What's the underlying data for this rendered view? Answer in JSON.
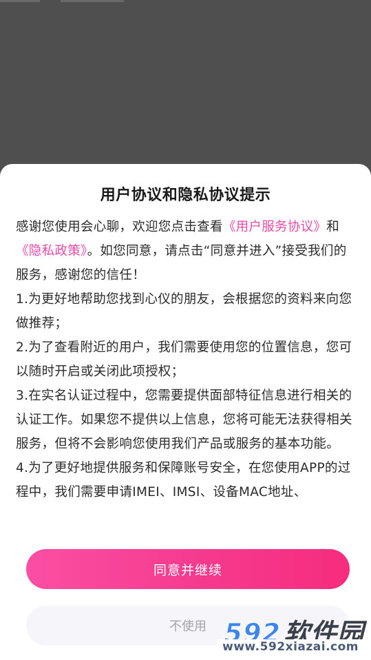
{
  "dialog": {
    "title": "用户协议和隐私协议提示",
    "paragraphs": {
      "intro_a": "感谢您使用会心聊，欢迎您点击查看",
      "user_agreement_link": "《用户服务协议》",
      "intro_b": "和",
      "privacy_link": "《隐私政策》",
      "intro_c": "。如您同意，请点击“同意并进入”接受我们的服务，感谢您的信任！",
      "item1": "1.为更好地帮助您找到心仪的朋友，会根据您的资料来向您做推荐；",
      "item2": "2.为了查看附近的用户，我们需要使用您的位置信息，您可以随时开启或关闭此项授权；",
      "item3": "3.在实名认证过程中，您需要提供面部特征信息进行相关的认证工作。如果您不提供以上信息，您将可能无法获得相关服务，但将不会影响您使用我们产品或服务的基本功能。",
      "item4": "4.为了更好地提供服务和保障账号安全，在您使用APP的过程中，我们需要申请IMEI、IMSI、设备MAC地址、"
    },
    "agree_label": "同意并继续",
    "decline_label": "不使用"
  },
  "watermark": {
    "brand_number": "592",
    "brand_text": "软件园",
    "url": "www.592xiazai.com"
  },
  "colors": {
    "link": "#ec4aa6",
    "agree_gradient_start": "#fb4fa3",
    "agree_gradient_end": "#f72c7d",
    "backdrop": "#4f4f4f"
  }
}
